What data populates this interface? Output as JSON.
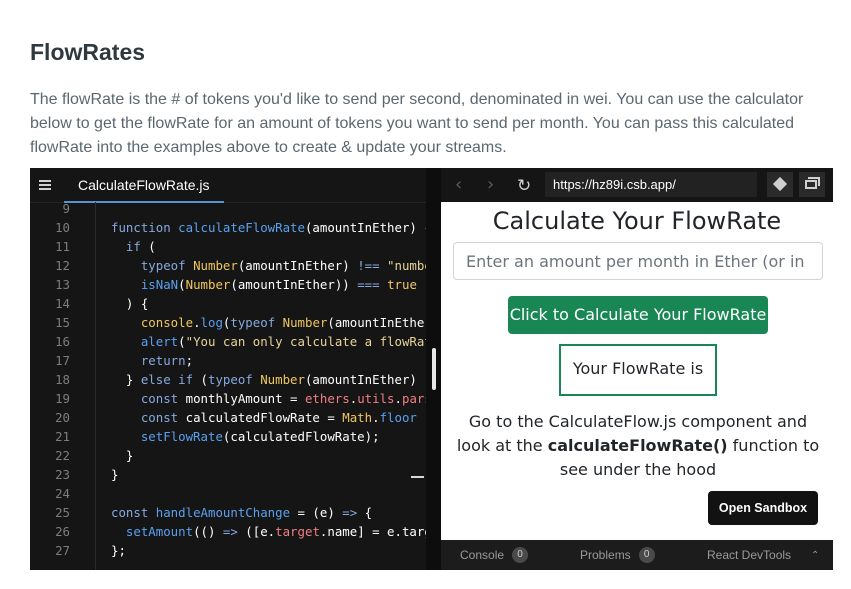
{
  "doc": {
    "title": "FlowRates",
    "description": "The flowRate is the # of tokens you'd like to send per second, denominated in wei. You can use the calculator below to get the flowRate for an amount of tokens you want to send per month. You can pass this calculated flowRate into the examples above to create & update your streams."
  },
  "editor": {
    "file_tab": "CalculateFlowRate.js",
    "lines": [
      {
        "n": "9",
        "tokens": []
      },
      {
        "n": "10",
        "tokens": [
          [
            "kw",
            "function "
          ],
          [
            "fn",
            "calculateFlowRate"
          ],
          [
            "pl",
            "(amountInEther) {"
          ]
        ]
      },
      {
        "n": "11",
        "tokens": [
          [
            "pl",
            "  "
          ],
          [
            "kw",
            "if"
          ],
          [
            "pl",
            " ("
          ]
        ]
      },
      {
        "n": "12",
        "tokens": [
          [
            "pl",
            "    "
          ],
          [
            "kw",
            "typeof "
          ],
          [
            "ty",
            "Number"
          ],
          [
            "pl",
            "(amountInEther) "
          ],
          [
            "kw",
            "!=="
          ],
          [
            "pl",
            " "
          ],
          [
            "st",
            "\"number\""
          ]
        ]
      },
      {
        "n": "13",
        "tokens": [
          [
            "pl",
            "    "
          ],
          [
            "fn",
            "isNaN"
          ],
          [
            "pl",
            "("
          ],
          [
            "ty",
            "Number"
          ],
          [
            "pl",
            "(amountInEther)) "
          ],
          [
            "kw",
            "==="
          ],
          [
            "pl",
            " "
          ],
          [
            "bo",
            "true"
          ]
        ]
      },
      {
        "n": "14",
        "tokens": [
          [
            "pl",
            "  ) {"
          ]
        ]
      },
      {
        "n": "15",
        "tokens": [
          [
            "pl",
            "    "
          ],
          [
            "ty",
            "console"
          ],
          [
            "pl",
            "."
          ],
          [
            "fn",
            "log"
          ],
          [
            "pl",
            "("
          ],
          [
            "kw",
            "typeof "
          ],
          [
            "ty",
            "Number"
          ],
          [
            "pl",
            "(amountInEther"
          ]
        ]
      },
      {
        "n": "16",
        "tokens": [
          [
            "pl",
            "    "
          ],
          [
            "fn",
            "alert"
          ],
          [
            "pl",
            "("
          ],
          [
            "st",
            "\"You can only calculate a flowRate"
          ]
        ]
      },
      {
        "n": "17",
        "tokens": [
          [
            "pl",
            "    "
          ],
          [
            "kw",
            "return"
          ],
          [
            "pl",
            ";"
          ]
        ]
      },
      {
        "n": "18",
        "tokens": [
          [
            "pl",
            "  } "
          ],
          [
            "kw",
            "else if"
          ],
          [
            "pl",
            " ("
          ],
          [
            "kw",
            "typeof "
          ],
          [
            "ty",
            "Number"
          ],
          [
            "pl",
            "(amountInEther) "
          ]
        ]
      },
      {
        "n": "19",
        "tokens": [
          [
            "pl",
            "    "
          ],
          [
            "kw",
            "const "
          ],
          [
            "pl",
            "monthlyAmount = "
          ],
          [
            "pr",
            "ethers"
          ],
          [
            "pl",
            "."
          ],
          [
            "pr",
            "utils"
          ],
          [
            "pl",
            "."
          ],
          [
            "pr",
            "parse"
          ]
        ]
      },
      {
        "n": "20",
        "tokens": [
          [
            "pl",
            "    "
          ],
          [
            "kw",
            "const "
          ],
          [
            "pl",
            "calculatedFlowRate = "
          ],
          [
            "ty",
            "Math"
          ],
          [
            "pl",
            "."
          ],
          [
            "fn",
            "floor"
          ]
        ]
      },
      {
        "n": "21",
        "tokens": [
          [
            "pl",
            "    "
          ],
          [
            "fn",
            "setFlowRate"
          ],
          [
            "pl",
            "(calculatedFlowRate);"
          ]
        ]
      },
      {
        "n": "22",
        "tokens": [
          [
            "pl",
            "  }"
          ]
        ]
      },
      {
        "n": "23",
        "tokens": [
          [
            "pl",
            "}"
          ]
        ]
      },
      {
        "n": "24",
        "tokens": []
      },
      {
        "n": "25",
        "tokens": [
          [
            "kw",
            "const "
          ],
          [
            "fn",
            "handleAmountChange"
          ],
          [
            "pl",
            " = (e) "
          ],
          [
            "kw",
            "=>"
          ],
          [
            "pl",
            " {"
          ]
        ]
      },
      {
        "n": "26",
        "tokens": [
          [
            "pl",
            "  "
          ],
          [
            "fn",
            "setAmount"
          ],
          [
            "pl",
            "(() "
          ],
          [
            "kw",
            "=>"
          ],
          [
            "pl",
            " ([e."
          ],
          [
            "pr",
            "target"
          ],
          [
            "pl",
            ".name] = e.target"
          ]
        ]
      },
      {
        "n": "27",
        "tokens": [
          [
            "pl",
            "};"
          ]
        ]
      }
    ]
  },
  "browser": {
    "url": "https://hz89i.csb.app/"
  },
  "app": {
    "heading": "Calculate Your FlowRate",
    "input_placeholder": "Enter an amount per month in Ether (or in dollars)",
    "calc_button": "Click to Calculate Your FlowRate",
    "result_label": "Your FlowRate is",
    "note_before": "Go to the CalculateFlow.js component and look at the ",
    "note_bold": "calculateFlowRate()",
    "note_after": " function to see under the hood",
    "open_sandbox": "Open Sandbox"
  },
  "devtools": {
    "console_label": "Console",
    "console_count": "0",
    "problems_label": "Problems",
    "problems_count": "0",
    "react_label": "React DevTools"
  },
  "icons": {
    "menu": "hamburger-menu-icon",
    "back": "chevron-left-icon",
    "forward": "chevron-right-icon",
    "reload": "reload-icon",
    "codesandbox": "codesandbox-icon",
    "new_window": "new-window-icon",
    "expand": "chevron-up-icon"
  },
  "colors": {
    "accent_green": "#198754",
    "tab_underline": "#5a8fd4"
  }
}
